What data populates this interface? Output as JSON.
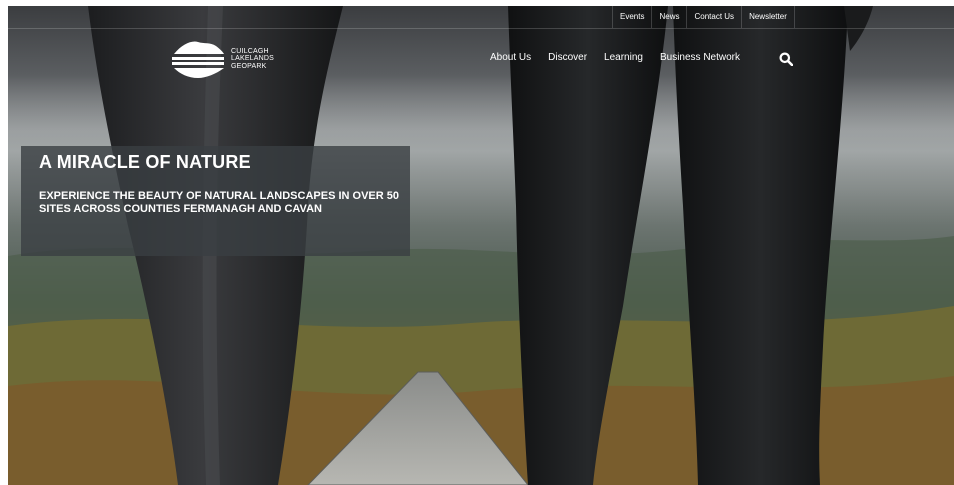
{
  "utility_nav": [
    "Events",
    "News",
    "Contact Us",
    "Newsletter"
  ],
  "logo": {
    "lines": [
      "CUILCAGH",
      "LAKELANDS",
      "GEOPARK"
    ]
  },
  "main_nav": [
    "About Us",
    "Discover",
    "Learning",
    "Business Network"
  ],
  "hero": {
    "title": "A MIRACLE OF NATURE",
    "subtitle": "EXPERIENCE THE BEAUTY OF NATURAL LANDSCAPES IN OVER 50 SITES ACROSS COUNTIES FERMANAGH AND CAVAN"
  },
  "icons": {
    "search": "search-icon",
    "logo": "geopark-logo-icon"
  },
  "colors": {
    "overlay": "#3a3e42",
    "text": "#ffffff"
  }
}
